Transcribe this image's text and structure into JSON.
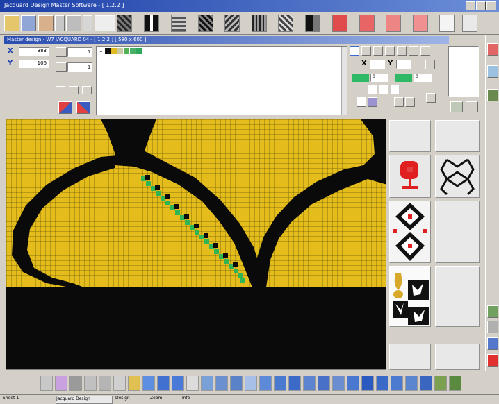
{
  "titlebar": {
    "title": "Jacquard Design Master Software - [ 1.2.2 ]"
  },
  "doc_bar": {
    "title": "Master design - W7 JACQUARD 04 - [ 1.2.2 ] [ 580 x 600 ]"
  },
  "coords": {
    "x_label": "X",
    "x_value": "383",
    "y_label": "Y",
    "y_value": "106"
  },
  "inputs": {
    "input1": "1",
    "input2": "1"
  },
  "color_fields": {
    "first": "0",
    "second": "0"
  },
  "axis_fields": {
    "x": "X",
    "y": "Y"
  },
  "palette_colors": [
    "#111111",
    "#e2bc22",
    "#c9c9a3",
    "#54b054",
    "#49b06a",
    "#2fa85c"
  ],
  "toolbar_swatches": [
    "#555555",
    "#1a1a1a",
    "#666666",
    "#202020",
    "#5a5a5a",
    "#333333",
    "#777777",
    "#444444",
    "#2a2a2a",
    "#e04c4c",
    "#e86565",
    "#ee8585"
  ],
  "canvas": {
    "base_color": "#e4bd1c",
    "outline_color": "#0a0a0a",
    "stripe_color": "#30b454"
  },
  "status": {
    "item1": "Sheet-1",
    "item2": "Jacquard Design",
    "item3": "Design",
    "item4": "Zoom",
    "item5": "Info"
  }
}
